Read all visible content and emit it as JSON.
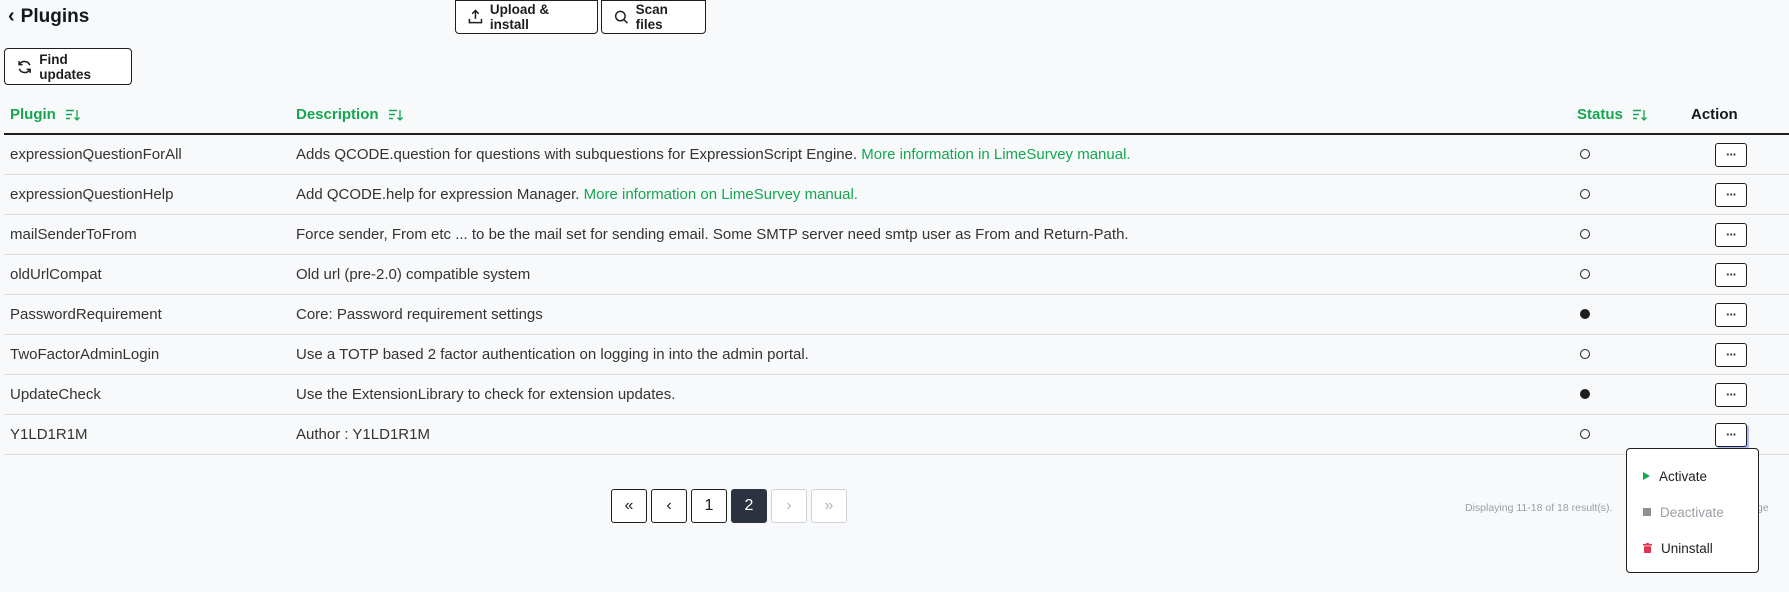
{
  "header": {
    "title": "Plugins"
  },
  "toolbar": {
    "upload_label": "Upload & install",
    "scan_label": "Scan files",
    "find_updates_label": "Find updates"
  },
  "table": {
    "columns": {
      "plugin": "Plugin",
      "description": "Description",
      "status": "Status",
      "action": "Action"
    },
    "rows": [
      {
        "name": "expressionQuestionForAll",
        "description": "Adds QCODE.question for questions with subquestions for ExpressionScript Engine.",
        "link": "More information in LimeSurvey manual.",
        "active": false
      },
      {
        "name": "expressionQuestionHelp",
        "description": "Add QCODE.help for expression Manager.",
        "link": "More information on LimeSurvey manual.",
        "active": false
      },
      {
        "name": "mailSenderToFrom",
        "description": "Force sender, From etc ... to be the mail set for sending email. Some SMTP server need smtp user as From and Return-Path.",
        "link": "",
        "active": false
      },
      {
        "name": "oldUrlCompat",
        "description": "Old url (pre-2.0) compatible system",
        "link": "",
        "active": false
      },
      {
        "name": "PasswordRequirement",
        "description": "Core: Password requirement settings",
        "link": "",
        "active": true
      },
      {
        "name": "TwoFactorAdminLogin",
        "description": "Use a TOTP based 2 factor authentication on logging in into the admin portal.",
        "link": "",
        "active": false
      },
      {
        "name": "UpdateCheck",
        "description": "Use the ExtensionLibrary to check for extension updates.",
        "link": "",
        "active": true
      },
      {
        "name": "Y1LD1R1M",
        "description": "Author : Y1LD1R1M",
        "link": "",
        "active": false
      }
    ],
    "action_label": "···"
  },
  "pagination": {
    "first": "«",
    "prev": "‹",
    "pages": [
      "1",
      "2"
    ],
    "current": "2",
    "next": "›",
    "last": "»",
    "summary": "Displaying 11-18 of 18 result(s).",
    "summary_tail": "ge"
  },
  "dropdown": {
    "items": [
      {
        "label": "Activate",
        "disabled": false
      },
      {
        "label": "Deactivate",
        "disabled": true
      },
      {
        "label": "Uninstall",
        "disabled": false
      }
    ]
  },
  "colors": {
    "accent": "#14a750",
    "active_page": "#2d3240",
    "danger": "#e0344c"
  }
}
